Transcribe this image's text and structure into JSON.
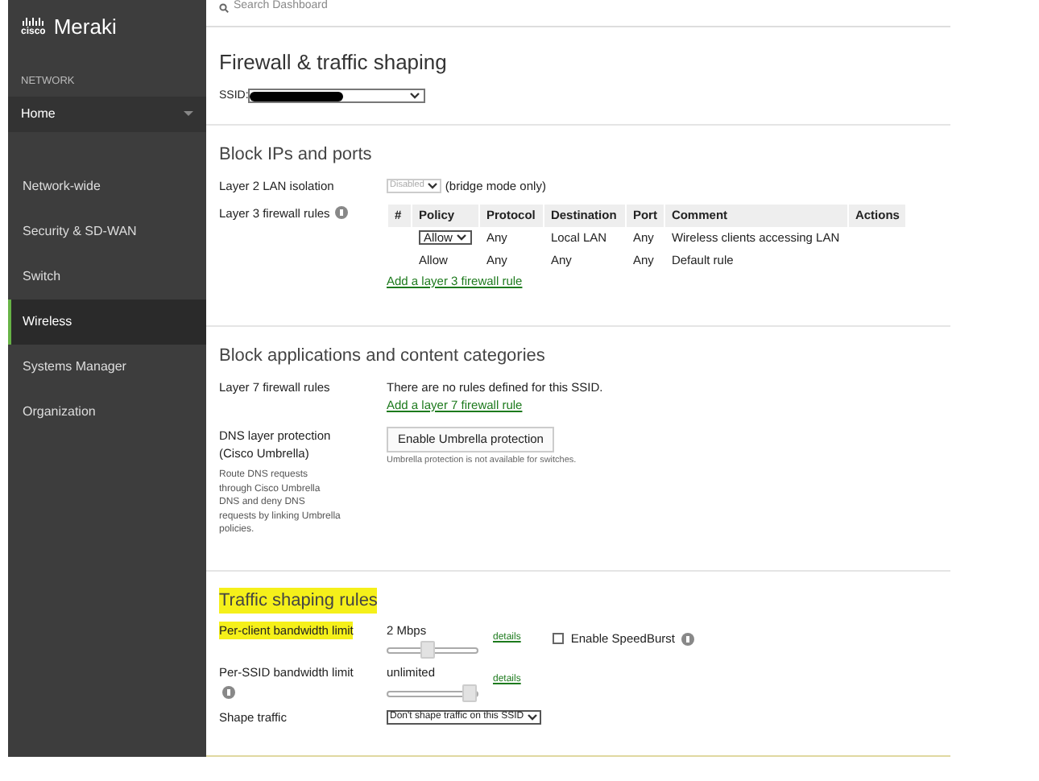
{
  "sidebar": {
    "logo": {
      "brand": "cisco",
      "product": "Meraki"
    },
    "section_label": "NETWORK",
    "network_select": {
      "value": "Home"
    },
    "items": [
      {
        "label": "Network-wide",
        "selected": false
      },
      {
        "label": "Security & SD-WAN",
        "selected": false
      },
      {
        "label": "Switch",
        "selected": false
      },
      {
        "label": "Wireless",
        "selected": true
      },
      {
        "label": "Systems Manager",
        "selected": false
      },
      {
        "label": "Organization",
        "selected": false
      }
    ]
  },
  "search": {
    "placeholder": "Search Dashboard"
  },
  "page_title": "Firewall & traffic shaping",
  "ssid": {
    "label": "SSID:"
  },
  "block_ips": {
    "title": "Block IPs and ports",
    "lan_isolation": {
      "label": "Layer 2 LAN isolation",
      "value": "Disabled",
      "disabled": true,
      "note": "(bridge mode only)"
    },
    "l3": {
      "label": "Layer 3 firewall rules",
      "columns": [
        "#",
        "Policy",
        "Protocol",
        "Destination",
        "Port",
        "Comment",
        "Actions"
      ],
      "rows": [
        {
          "kind": "editable",
          "cells": [
            "",
            "Allow",
            "Any",
            "Local LAN",
            "Any",
            "Wireless clients accessing LAN",
            ""
          ]
        },
        {
          "kind": "fixed",
          "cells": [
            "",
            "Allow",
            "Any",
            "Any",
            "Any",
            "Default rule",
            ""
          ]
        }
      ],
      "add_link": "Add a layer 3 firewall rule"
    }
  },
  "block_apps": {
    "title": "Block applications and content categories",
    "l7": {
      "label": "Layer 7 firewall rules",
      "message": "There are no rules defined for this SSID.",
      "add_link": "Add a layer 7 firewall rule"
    },
    "dns": {
      "label": "DNS layer protection (Cisco Umbrella)",
      "description": "Route DNS requests through Cisco Umbrella DNS and deny DNS requests by linking Umbrella policies.",
      "button": "Enable Umbrella protection",
      "note": "Umbrella protection is not available for switches."
    }
  },
  "traffic": {
    "title": "Traffic shaping rules",
    "title_highlighted": true,
    "limits": [
      {
        "label": "Per-client bandwidth limit",
        "highlighted": true,
        "info": false,
        "reading": "2 Mbps",
        "level": 0.44,
        "details": "details",
        "speedburst": {
          "label": "Enable SpeedBurst",
          "checked": false
        }
      },
      {
        "label": "Per-SSID bandwidth limit",
        "highlighted": false,
        "info": true,
        "reading": "unlimited",
        "level": 1.0,
        "details": "details"
      }
    ],
    "shape": {
      "label": "Shape traffic",
      "value": "Don't shape traffic on this SSID"
    }
  }
}
